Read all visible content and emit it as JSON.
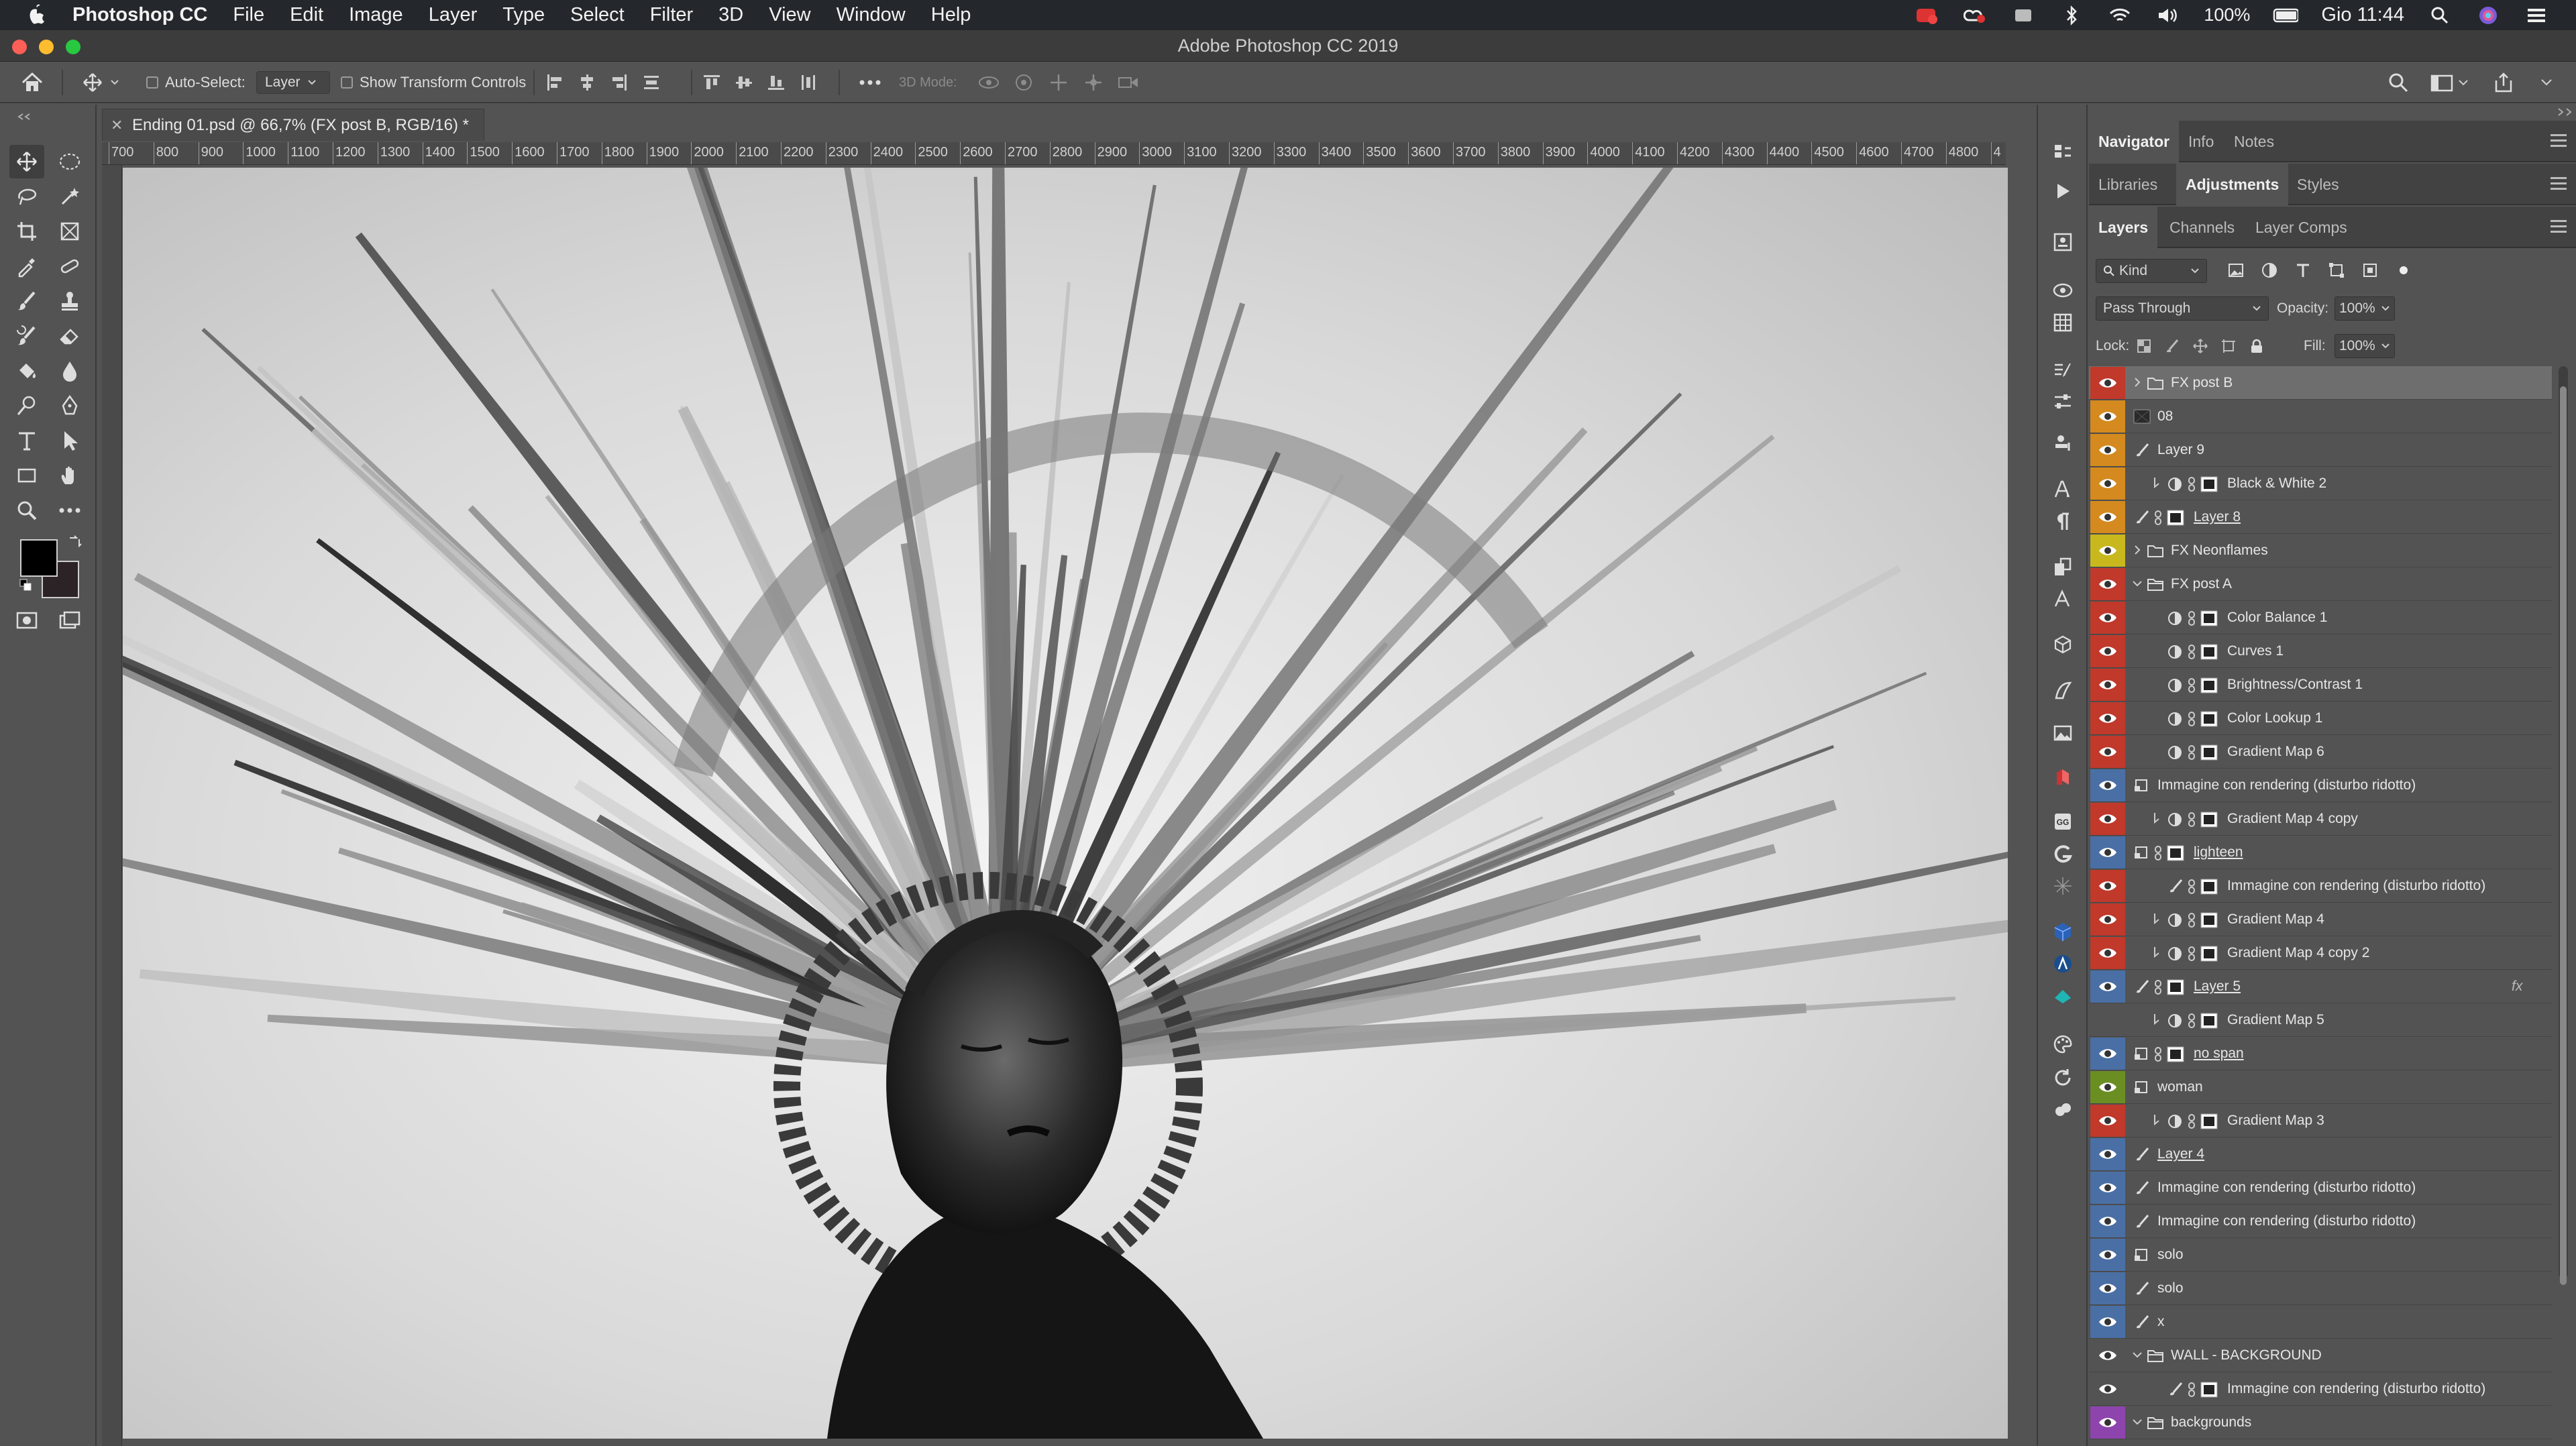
{
  "menubar": {
    "app_name": "Photoshop CC",
    "menus": [
      "File",
      "Edit",
      "Image",
      "Layer",
      "Type",
      "Select",
      "Filter",
      "3D",
      "View",
      "Window",
      "Help"
    ],
    "battery_label": "100%",
    "clock": "Gio 11:44"
  },
  "window": {
    "title": "Adobe Photoshop CC 2019"
  },
  "options": {
    "auto_select_label": "Auto-Select:",
    "auto_select_value": "Layer",
    "transform_label": "Show Transform Controls",
    "mode_3d_label": "3D Mode:"
  },
  "document": {
    "tab_title": "Ending 01.psd @ 66,7% (FX post B, RGB/16) *",
    "ruler_ticks": [
      "700",
      "800",
      "900",
      "1000",
      "1100",
      "1200",
      "1300",
      "1400",
      "1500",
      "1600",
      "1700",
      "1800",
      "1900",
      "2000",
      "2100",
      "2200",
      "2300",
      "2400",
      "2500",
      "2600",
      "2700",
      "2800",
      "2900",
      "3000",
      "3100",
      "3200",
      "3300",
      "3400",
      "3500",
      "3600",
      "3700",
      "3800",
      "3900",
      "4000",
      "4100",
      "4200",
      "4300",
      "4400",
      "4500",
      "4600",
      "4700",
      "4800",
      "4"
    ]
  },
  "panels": {
    "group1_tabs": [
      "Navigator",
      "Info",
      "Notes"
    ],
    "group2_tabs": [
      "Libraries",
      "Adjustments",
      "Styles"
    ],
    "group3_tabs": [
      "Layers",
      "Channels",
      "Layer Comps"
    ],
    "filter_kind": "Kind",
    "blend_mode": "Pass Through",
    "opacity_label": "Opacity:",
    "opacity_value": "100%",
    "lock_label": "Lock:",
    "fill_label": "Fill:",
    "fill_value": "100%"
  },
  "layers": [
    {
      "name": "FX post B",
      "tag": "#c0392b",
      "kind": "group",
      "indent": 0,
      "selected": true,
      "arrow": true
    },
    {
      "name": "08",
      "tag": "#d48a1e",
      "kind": "pixel-dark",
      "indent": 0
    },
    {
      "name": "Layer 9",
      "tag": "#d48a1e",
      "kind": "brush",
      "indent": 0
    },
    {
      "name": "Black & White 2",
      "tag": "#d48a1e",
      "kind": "adjust",
      "indent": 1,
      "clip": true
    },
    {
      "name": "Layer 8",
      "tag": "#d48a1e",
      "kind": "brush-mask",
      "indent": 0,
      "underline": true
    },
    {
      "name": "FX Neonflames",
      "tag": "#c8b81e",
      "kind": "group",
      "indent": 0,
      "arrow": true
    },
    {
      "name": "FX post A",
      "tag": "#c0392b",
      "kind": "group-open",
      "indent": 0,
      "arrow": true
    },
    {
      "name": "Color Balance 1",
      "tag": "#c0392b",
      "kind": "adjust",
      "indent": 1
    },
    {
      "name": "Curves 1",
      "tag": "#c0392b",
      "kind": "adjust",
      "indent": 1
    },
    {
      "name": "Brightness/Contrast 1",
      "tag": "#c0392b",
      "kind": "adjust",
      "indent": 1
    },
    {
      "name": "Color Lookup 1",
      "tag": "#c0392b",
      "kind": "adjust",
      "indent": 1
    },
    {
      "name": "Gradient Map 6",
      "tag": "#c0392b",
      "kind": "adjust",
      "indent": 1
    },
    {
      "name": "Immagine con rendering (disturbo ridotto)",
      "tag": "#4a6fa5",
      "kind": "smart",
      "indent": 0
    },
    {
      "name": "Gradient Map 4 copy",
      "tag": "#c0392b",
      "kind": "adjust",
      "indent": 1,
      "clip": true
    },
    {
      "name": "lighteen",
      "tag": "#4a6fa5",
      "kind": "smart-mask",
      "indent": 0,
      "underline": true
    },
    {
      "name": "Immagine con rendering (disturbo ridotto)",
      "tag": "#c0392b",
      "kind": "brush-mask",
      "indent": 1
    },
    {
      "name": "Gradient Map 4",
      "tag": "#c0392b",
      "kind": "adjust",
      "indent": 1,
      "clip": true
    },
    {
      "name": "Gradient Map 4 copy 2",
      "tag": "#c0392b",
      "kind": "adjust",
      "indent": 1,
      "clip": true
    },
    {
      "name": "Layer 5",
      "tag": "#4a6fa5",
      "kind": "brush-mask",
      "indent": 0,
      "underline": true,
      "fx": "fx"
    },
    {
      "name": "Gradient Map 5",
      "tag": "#535353",
      "kind": "adjust",
      "indent": 1,
      "clip": true,
      "hidden": true
    },
    {
      "name": "no span",
      "tag": "#4a6fa5",
      "kind": "smart-mask",
      "indent": 0,
      "underline": true
    },
    {
      "name": "woman",
      "tag": "#6b8e23",
      "kind": "smart",
      "indent": 0
    },
    {
      "name": "Gradient Map 3",
      "tag": "#c0392b",
      "kind": "adjust",
      "indent": 1,
      "clip": true
    },
    {
      "name": "Layer 4",
      "tag": "#4a6fa5",
      "kind": "brush",
      "indent": 0,
      "underline": true
    },
    {
      "name": "Immagine con rendering (disturbo ridotto)",
      "tag": "#4a6fa5",
      "kind": "brush",
      "indent": 0
    },
    {
      "name": "Immagine con rendering (disturbo ridotto)",
      "tag": "#4a6fa5",
      "kind": "brush",
      "indent": 0
    },
    {
      "name": "solo",
      "tag": "#4a6fa5",
      "kind": "smart",
      "indent": 0
    },
    {
      "name": "solo",
      "tag": "#4a6fa5",
      "kind": "brush",
      "indent": 0
    },
    {
      "name": "x",
      "tag": "#4a6fa5",
      "kind": "brush",
      "indent": 0
    },
    {
      "name": "WALL - BACKGROUND",
      "tag": "#535353",
      "kind": "group-open",
      "indent": 0,
      "arrow": true
    },
    {
      "name": "Immagine con rendering (disturbo ridotto)",
      "tag": "#535353",
      "kind": "brush-mask",
      "indent": 1
    },
    {
      "name": "backgrounds",
      "tag": "#8e44ad",
      "kind": "group-open",
      "indent": 0,
      "arrow": true
    }
  ]
}
